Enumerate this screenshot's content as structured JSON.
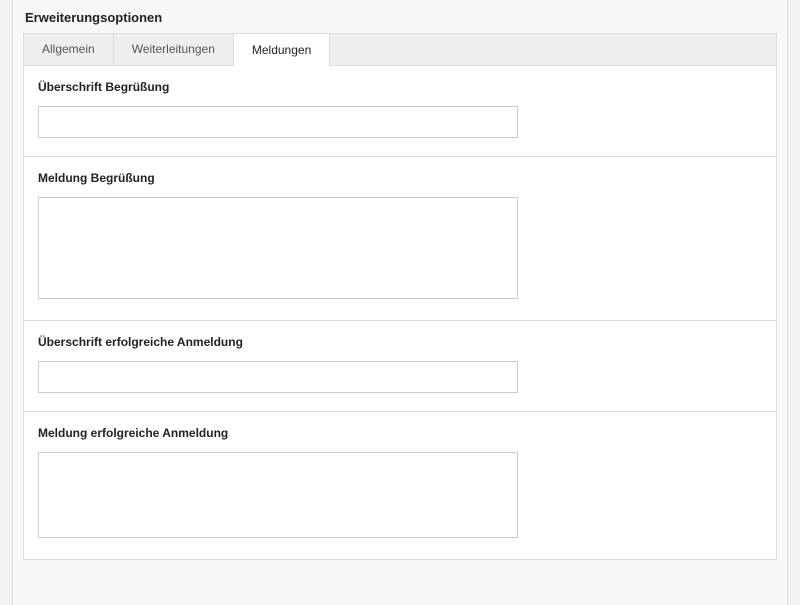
{
  "section_title": "Erweiterungsoptionen",
  "tabs": [
    {
      "label": "Allgemein",
      "active": false
    },
    {
      "label": "Weiterleitungen",
      "active": false
    },
    {
      "label": "Meldungen",
      "active": true
    }
  ],
  "fields": {
    "greeting_heading": {
      "label": "Überschrift Begrüßung",
      "value": ""
    },
    "greeting_message": {
      "label": "Meldung Begrüßung",
      "value": ""
    },
    "success_heading": {
      "label": "Überschrift erfolgreiche Anmeldung",
      "value": ""
    },
    "success_message": {
      "label": "Meldung erfolgreiche Anmeldung",
      "value": ""
    }
  }
}
